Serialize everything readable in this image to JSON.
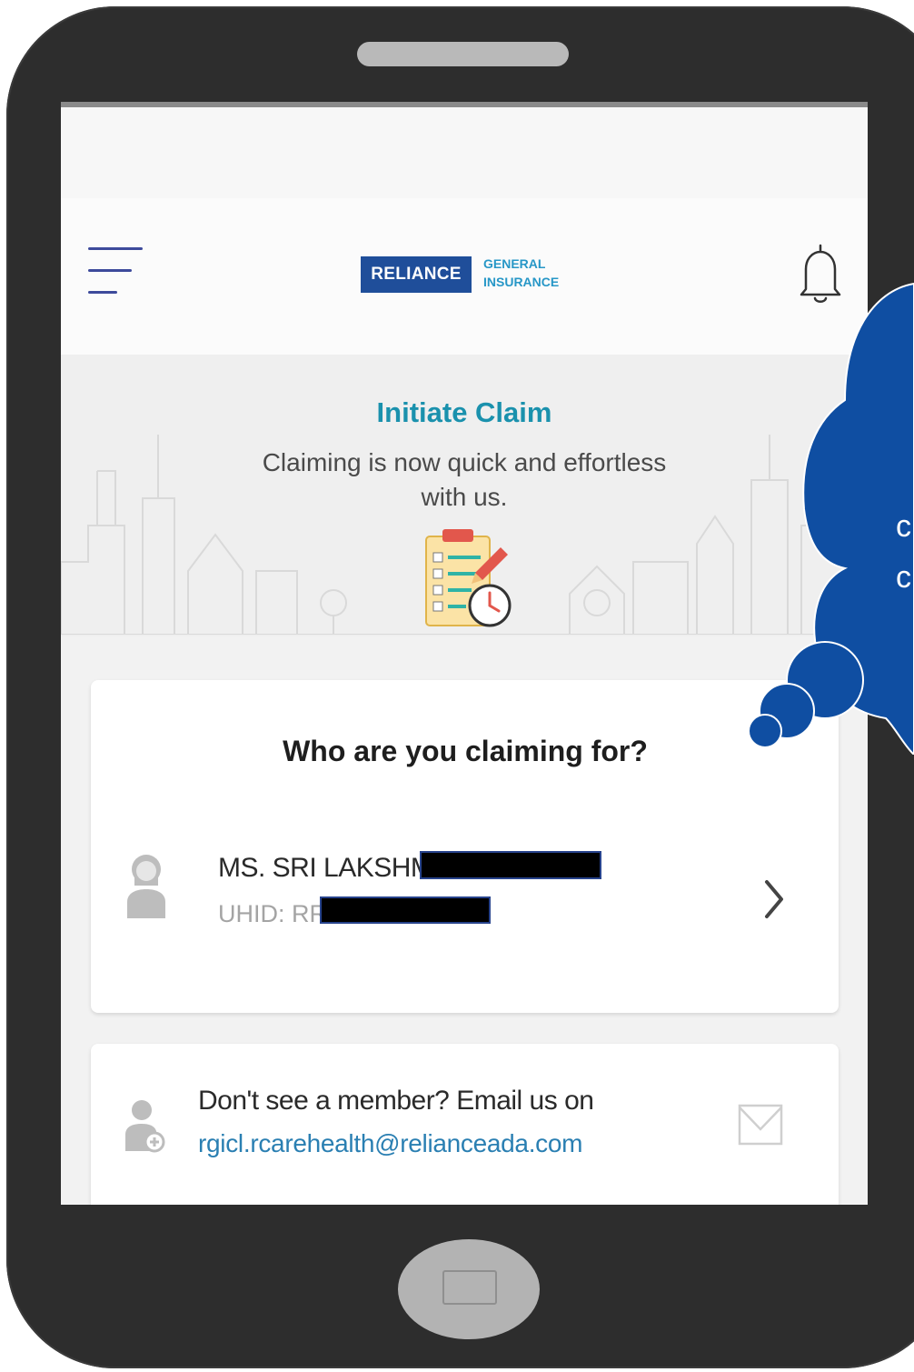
{
  "app": {
    "logo_primary": "RELIANCE",
    "logo_secondary_line1": "GENERAL",
    "logo_secondary_line2": "INSURANCE"
  },
  "banner": {
    "title": "Initiate Claim",
    "subtitle": "Claiming is now quick and effortless with us."
  },
  "claim_card": {
    "question": "Who are you claiming for?",
    "member": {
      "name": "MS. SRI LAKSHMI",
      "uhid_prefix": "UHID: RR"
    }
  },
  "member_card": {
    "message": "Don't see a member? Email us on",
    "email": "rgicl.rcarehealth@relianceada.com"
  },
  "callout": {
    "line1": "c",
    "line2": "c"
  },
  "colors": {
    "phone_frame": "#2d2d2d",
    "accent_teal": "#1a91ad",
    "brand_blue": "#1f4e9a",
    "cloud_blue": "#0f4ea2",
    "link_blue": "#2a7fb2"
  },
  "icons": {
    "menu": "hamburger-icon",
    "notifications": "bell-icon",
    "illustration": "clipboard-clock-icon",
    "member_avatar": "female-user-icon",
    "chevron": "chevron-right-icon",
    "add_member": "add-user-icon",
    "mail": "envelope-icon"
  }
}
